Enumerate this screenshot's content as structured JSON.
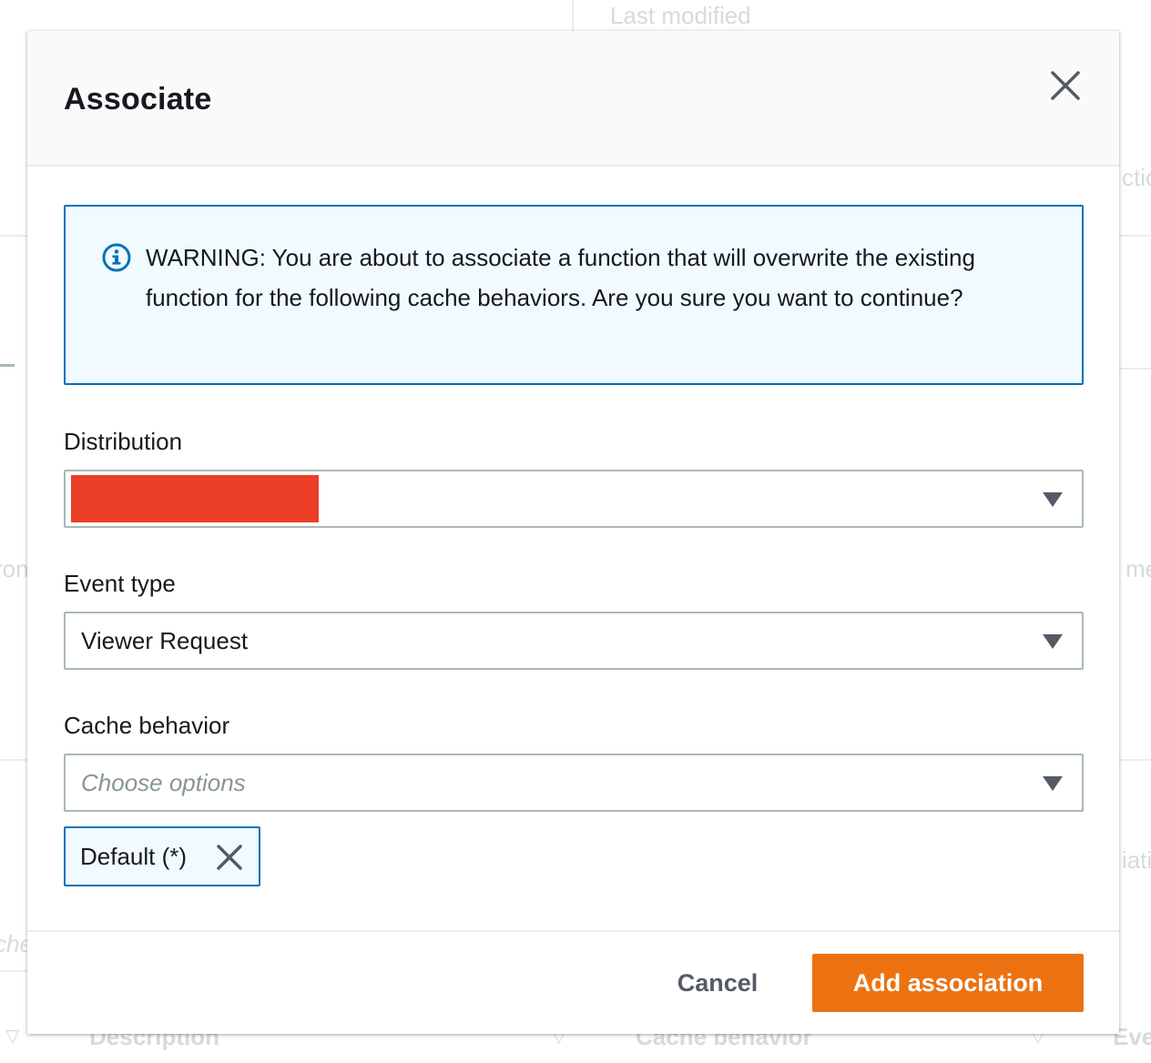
{
  "background": {
    "column_last_modified": "Last modified",
    "column_description": "Description",
    "column_cache_behavior": "Cache behavior",
    "fragment_right_top": "ctio",
    "fragment_left_mid": "ron",
    "fragment_right_mid": "me",
    "fragment_right_low": "iati",
    "fragment_left_low": "che",
    "fragment_right_bottom": "Eve"
  },
  "modal": {
    "title": "Associate",
    "close_icon": "close-icon",
    "alert": {
      "icon": "info-icon",
      "text": "WARNING: You are about to associate a function that will overwrite the existing function for the following cache behaviors. Are you sure you want to continue?",
      "border_color": "#0073bb",
      "background_color": "#f1faff"
    },
    "distribution": {
      "label": "Distribution",
      "value_redacted": true,
      "redaction_color": "#ea3f26"
    },
    "event_type": {
      "label": "Event type",
      "value": "Viewer Request"
    },
    "cache_behavior": {
      "label": "Cache behavior",
      "placeholder": "Choose options",
      "selected_tokens": [
        "Default (*)"
      ]
    },
    "footer": {
      "cancel_label": "Cancel",
      "primary_label": "Add association",
      "primary_color": "#ec7211"
    }
  }
}
